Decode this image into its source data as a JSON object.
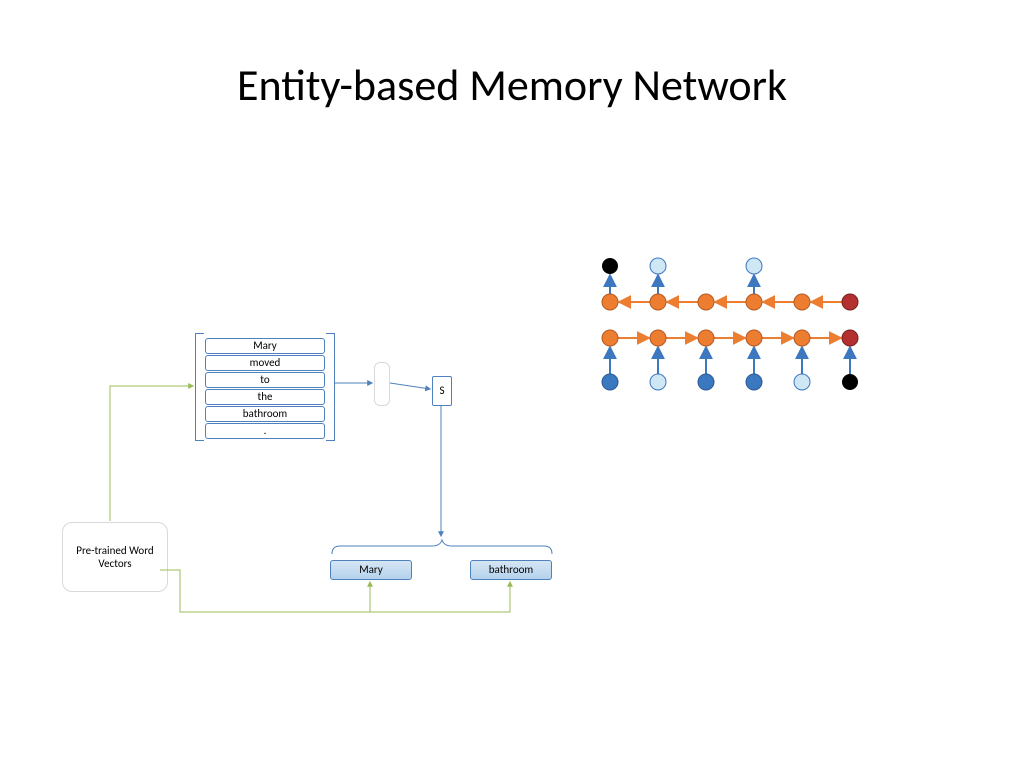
{
  "title": "Entity-based Memory Network",
  "pretrained_label": "Pre-trained Word Vectors",
  "sentence": {
    "w0": "Mary",
    "w1": "moved",
    "w2": "to",
    "w3": "the",
    "w4": "bathroom",
    "w5": "."
  },
  "s_label": "S",
  "entities": {
    "e0": "Mary",
    "e1": "bathroom"
  },
  "graph": {
    "colors": {
      "black": "#000000",
      "light": "#cfe6f5",
      "blue": "#3c78c0",
      "orange": "#ed7d31",
      "red": "#b23030"
    },
    "top_nodes": [
      "black",
      "light",
      "",
      "light"
    ],
    "row_a_nodes": [
      "orange",
      "orange",
      "orange",
      "orange",
      "orange",
      "red"
    ],
    "row_b_nodes": [
      "orange",
      "orange",
      "orange",
      "orange",
      "orange",
      "red"
    ],
    "bottom_nodes": [
      "blue",
      "light",
      "blue",
      "blue",
      "light",
      "black"
    ]
  }
}
